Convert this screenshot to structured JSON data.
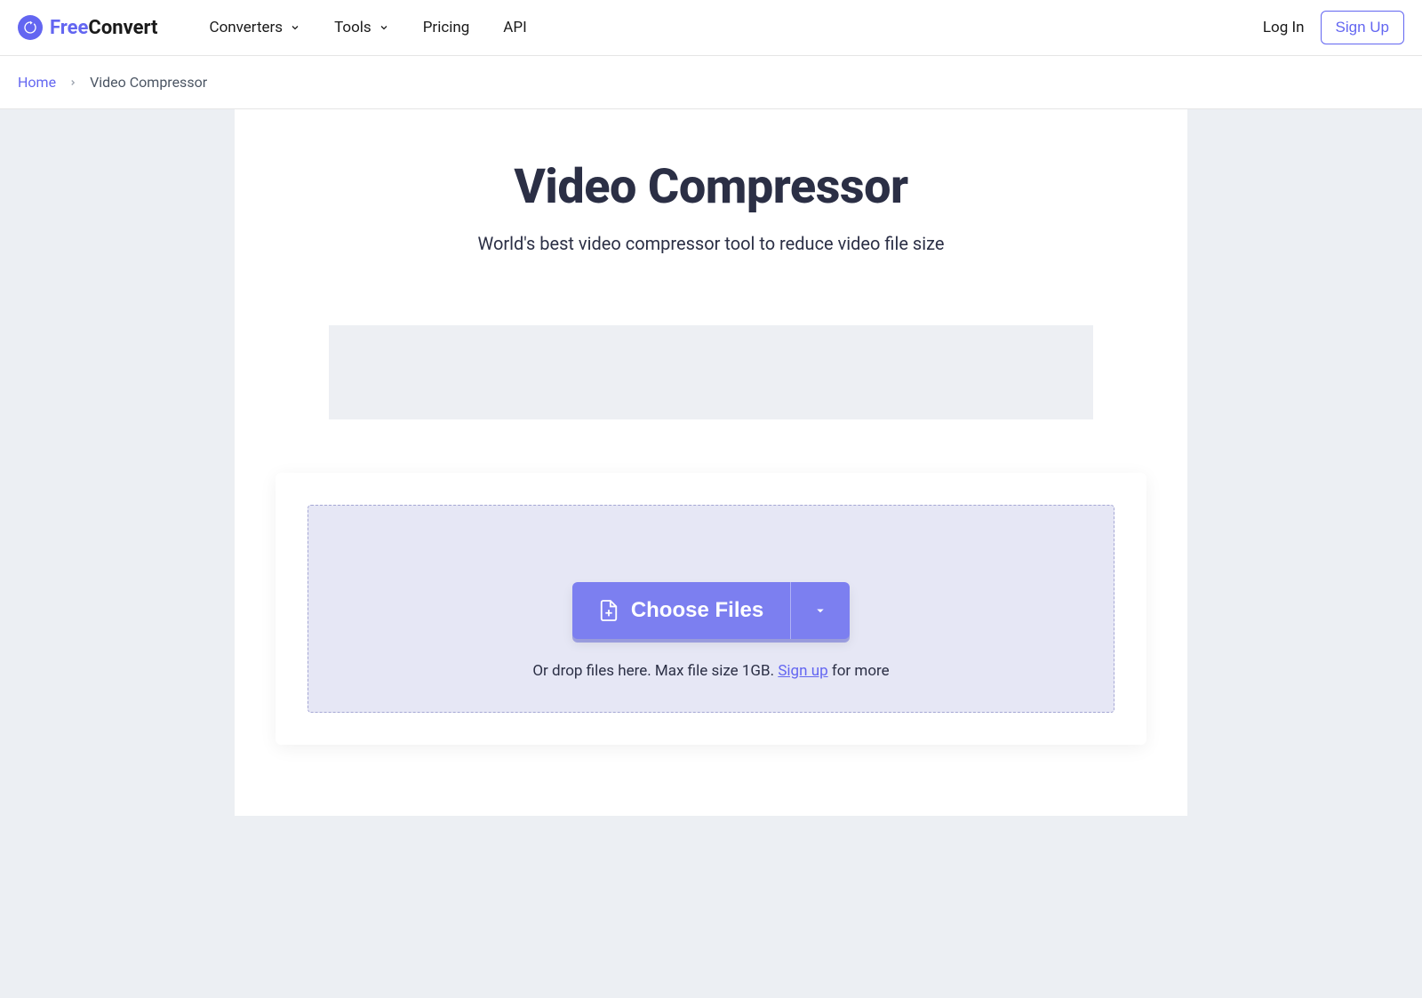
{
  "header": {
    "logo_free": "Free",
    "logo_convert": "Convert",
    "nav": {
      "converters": "Converters",
      "tools": "Tools",
      "pricing": "Pricing",
      "api": "API"
    },
    "login": "Log In",
    "signup": "Sign Up"
  },
  "breadcrumb": {
    "home": "Home",
    "current": "Video Compressor"
  },
  "main": {
    "title": "Video Compressor",
    "subtitle": "World's best video compressor tool to reduce video file size",
    "choose_files": "Choose Files",
    "drop_prefix": "Or drop files here. Max file size 1GB. ",
    "signup_link": "Sign up",
    "drop_suffix": " for more"
  }
}
